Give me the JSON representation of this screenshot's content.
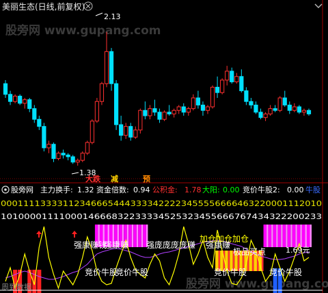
{
  "header": {
    "title": "美丽生态(日线,前复权)"
  },
  "watermark": "股旁网 www.gupang.com",
  "top_chart": {
    "high_label": "2.13",
    "low_label": "1.38",
    "signals": [
      {
        "text": "大跌",
        "color": "#ff3030"
      },
      {
        "text": "减",
        "color": "#ffd000"
      },
      {
        "text": "预",
        "color": "#ff8800"
      }
    ]
  },
  "indicator": {
    "title": "股旁网",
    "fields": [
      {
        "label": "主力换手:",
        "value": "1.32",
        "color": "#ffffff"
      },
      {
        "label": "资金倍数:",
        "value": "0.94",
        "color": "#ffffff"
      },
      {
        "label": "公积金:",
        "value": "1.78",
        "color": "#ff3030"
      },
      {
        "label": "大阳:",
        "value": "0.00",
        "color": "#00ff00"
      },
      {
        "label": "竞价牛股2:",
        "value": "0.00",
        "color": "#ffffff"
      }
    ],
    "suffix": "牛股",
    "digit_rows": [
      "000111133331123466654443333422223455556666463220001112010",
      "1010000111100014666832233334525323455666767434322200233"
    ],
    "labels": [
      {
        "text": "强康赚钱",
        "color": "#ffffff"
      },
      {
        "text": "强康赚",
        "color": "#ffffff"
      },
      {
        "text": "强庞庞庞庞赚",
        "color": "#ffffff"
      },
      {
        "text": "加仓加仓加仓",
        "color": "#ffff00"
      },
      {
        "text": "强康赚",
        "color": "#ffffff"
      },
      {
        "text": "极品买点",
        "color": "#ffffff"
      },
      {
        "text": "1.69元",
        "color": "#ffffff"
      },
      {
        "text": "竞价牛股",
        "color": "#ffffff"
      },
      {
        "text": "竞价牛股",
        "color": "#ffffff"
      },
      {
        "text": "竞价牛股",
        "color": "#ffffff"
      },
      {
        "text": "竞价牛股",
        "color": "#ffffff"
      },
      {
        "text": "周到数据",
        "color": "#888888"
      }
    ]
  },
  "colors": {
    "up": "#ff3030",
    "down": "#00e0ff",
    "axis": "#a00000",
    "dotgrid": "#7a0000",
    "magenta": "#ff00ff",
    "yellow": "#ffff00"
  },
  "chart_data": [
    {
      "type": "candlestick",
      "title": "美丽生态(日线,前复权)",
      "ohlc": [
        [
          1.84,
          1.86,
          1.76,
          1.78
        ],
        [
          1.78,
          1.8,
          1.72,
          1.74
        ],
        [
          1.74,
          1.78,
          1.73,
          1.77
        ],
        [
          1.77,
          1.78,
          1.72,
          1.73
        ],
        [
          1.73,
          1.76,
          1.7,
          1.75
        ],
        [
          1.75,
          1.76,
          1.68,
          1.7
        ],
        [
          1.7,
          1.72,
          1.62,
          1.64
        ],
        [
          1.64,
          1.66,
          1.58,
          1.6
        ],
        [
          1.6,
          1.62,
          1.46,
          1.48
        ],
        [
          1.48,
          1.52,
          1.45,
          1.5
        ],
        [
          1.5,
          1.51,
          1.4,
          1.42
        ],
        [
          1.42,
          1.46,
          1.41,
          1.45
        ],
        [
          1.45,
          1.47,
          1.42,
          1.44
        ],
        [
          1.44,
          1.45,
          1.41,
          1.43
        ],
        [
          1.43,
          1.44,
          1.39,
          1.4
        ],
        [
          1.4,
          1.42,
          1.38,
          1.41
        ],
        [
          1.41,
          1.46,
          1.4,
          1.45
        ],
        [
          1.45,
          1.52,
          1.44,
          1.51
        ],
        [
          1.51,
          1.64,
          1.5,
          1.63
        ],
        [
          1.63,
          1.76,
          1.62,
          1.74
        ],
        [
          1.74,
          1.85,
          1.72,
          1.84
        ],
        [
          1.84,
          2.13,
          1.82,
          2.02
        ],
        [
          2.02,
          2.04,
          1.8,
          1.84
        ],
        [
          1.84,
          1.86,
          1.58,
          1.61
        ],
        [
          1.61,
          1.66,
          1.52,
          1.55
        ],
        [
          1.55,
          1.62,
          1.53,
          1.6
        ],
        [
          1.6,
          1.62,
          1.52,
          1.54
        ],
        [
          1.54,
          1.6,
          1.53,
          1.58
        ],
        [
          1.58,
          1.7,
          1.56,
          1.69
        ],
        [
          1.69,
          1.74,
          1.64,
          1.66
        ],
        [
          1.66,
          1.72,
          1.64,
          1.7
        ],
        [
          1.7,
          1.75,
          1.66,
          1.68
        ],
        [
          1.68,
          1.7,
          1.62,
          1.64
        ],
        [
          1.64,
          1.69,
          1.63,
          1.68
        ],
        [
          1.68,
          1.72,
          1.66,
          1.67
        ],
        [
          1.67,
          1.7,
          1.65,
          1.69
        ],
        [
          1.69,
          1.72,
          1.67,
          1.71
        ],
        [
          1.71,
          1.73,
          1.66,
          1.68
        ],
        [
          1.68,
          1.71,
          1.66,
          1.7
        ],
        [
          1.7,
          1.78,
          1.69,
          1.76
        ],
        [
          1.76,
          1.8,
          1.7,
          1.72
        ],
        [
          1.72,
          1.74,
          1.66,
          1.69
        ],
        [
          1.69,
          1.72,
          1.67,
          1.71
        ],
        [
          1.71,
          1.83,
          1.7,
          1.82
        ],
        [
          1.82,
          1.88,
          1.76,
          1.79
        ],
        [
          1.79,
          1.87,
          1.78,
          1.86
        ],
        [
          1.86,
          1.94,
          1.83,
          1.91
        ],
        [
          1.91,
          1.93,
          1.84,
          1.85
        ],
        [
          1.85,
          1.9,
          1.84,
          1.88
        ],
        [
          1.88,
          1.92,
          1.79,
          1.8
        ],
        [
          1.8,
          1.82,
          1.72,
          1.74
        ],
        [
          1.74,
          1.76,
          1.7,
          1.72
        ],
        [
          1.72,
          1.74,
          1.67,
          1.68
        ],
        [
          1.68,
          1.7,
          1.64,
          1.65
        ],
        [
          1.65,
          1.68,
          1.63,
          1.67
        ],
        [
          1.67,
          1.72,
          1.66,
          1.7
        ],
        [
          1.7,
          1.72,
          1.68,
          1.69
        ],
        [
          1.69,
          1.77,
          1.68,
          1.76
        ],
        [
          1.76,
          1.8,
          1.71,
          1.72
        ],
        [
          1.72,
          1.74,
          1.67,
          1.69
        ],
        [
          1.69,
          1.73,
          1.68,
          1.71
        ],
        [
          1.71,
          1.72,
          1.67,
          1.68
        ],
        [
          1.68,
          1.7,
          1.66,
          1.69
        ],
        [
          1.69,
          1.7,
          1.66,
          1.67
        ]
      ],
      "ylim": [
        1.33,
        2.24
      ]
    },
    {
      "type": "bar+line",
      "series": [
        {
          "type": "magenta_bars",
          "values": [
            0,
            0,
            0,
            0,
            0,
            0,
            0,
            0,
            0,
            0,
            0,
            0,
            0,
            0,
            0,
            0,
            0,
            0,
            0,
            1,
            1,
            1,
            1,
            1,
            1,
            1,
            1,
            1,
            1,
            1,
            0,
            0,
            0,
            0,
            0,
            0,
            0,
            0,
            0,
            0,
            0,
            0,
            0,
            0,
            0,
            0,
            0,
            0,
            0,
            0,
            0,
            0,
            0,
            0,
            1,
            1,
            1,
            1,
            1,
            1,
            1,
            1,
            1,
            1
          ]
        },
        {
          "type": "yellow_bars",
          "values": [
            0,
            0,
            0,
            0,
            0,
            0,
            0,
            0,
            0,
            0,
            0,
            0,
            0,
            0,
            0,
            0,
            0,
            0,
            0,
            0,
            0,
            0,
            0,
            0,
            0,
            0,
            0,
            0,
            0,
            0,
            0,
            0,
            0,
            0,
            0,
            0,
            0,
            0,
            0,
            0,
            0,
            0,
            0,
            0,
            1,
            1,
            1,
            1,
            1,
            1,
            1,
            1,
            1,
            1,
            0,
            0,
            0,
            0,
            0,
            0,
            0,
            0,
            0,
            0
          ]
        },
        {
          "type": "red_bars",
          "values": [
            0,
            0,
            1,
            1,
            0,
            1,
            1,
            1,
            0,
            0,
            0,
            0,
            0,
            0,
            0,
            0,
            0,
            0,
            0,
            0,
            0,
            0,
            0,
            0,
            0,
            0,
            0,
            0,
            0,
            0,
            0,
            0,
            0,
            0,
            0,
            0,
            0,
            0,
            0,
            0,
            0,
            0,
            0,
            0,
            0,
            0,
            0,
            0,
            0,
            0,
            0,
            0,
            0,
            0,
            0,
            0,
            0,
            0,
            0,
            0,
            0,
            0,
            0,
            0
          ]
        },
        {
          "type": "blue_bars",
          "values": [
            0,
            0,
            0,
            0,
            0,
            0,
            0,
            0,
            0,
            0,
            0,
            0,
            0,
            0,
            0,
            0,
            0,
            0,
            0,
            0,
            0,
            0,
            0,
            0,
            0,
            0,
            0,
            0,
            0,
            0,
            0,
            0,
            0,
            0,
            0,
            0,
            0,
            0,
            0,
            0,
            0,
            0,
            0,
            0,
            0,
            0,
            0,
            0,
            0,
            0,
            0,
            0,
            0,
            0,
            0,
            0,
            1,
            1,
            0,
            0,
            0,
            0,
            0,
            0
          ]
        },
        {
          "type": "yellow_line",
          "values": [
            0.15,
            0.35,
            0.05,
            0.25,
            0.55,
            0.3,
            0.1,
            0.65,
            0.95,
            0.5,
            0.25,
            0.05,
            0.3,
            0.2,
            0.1,
            0.25,
            0.5,
            0.8,
            0.6,
            0.3,
            0.15,
            0.1,
            0.12,
            0.35,
            0.55,
            0.75,
            0.5,
            0.32,
            0.25,
            0.2,
            0.4,
            0.55,
            0.45,
            0.2,
            0.1,
            0.3,
            0.55,
            0.95,
            0.7,
            0.4,
            0.55,
            0.75,
            0.5,
            0.35,
            0.9,
            0.6,
            0.3,
            0.12,
            0.1,
            0.2,
            0.4,
            0.75,
            0.6,
            0.35,
            0.15,
            0.25,
            0.55,
            0.35,
            0.15,
            0.3,
            0.5,
            0.7,
            0.45,
            0.5
          ]
        },
        {
          "type": "purple_line",
          "values": [
            0.2,
            0.22,
            0.25,
            0.28,
            0.3,
            0.28,
            0.25,
            0.22,
            0.2,
            0.18,
            0.18,
            0.2,
            0.22,
            0.25,
            0.28,
            0.3,
            0.35,
            0.4,
            0.48,
            0.55,
            0.58,
            0.6,
            0.62,
            0.63,
            0.62,
            0.6,
            0.58,
            0.55,
            0.52,
            0.5,
            0.5,
            0.52,
            0.55,
            0.57,
            0.58,
            0.6,
            0.62,
            0.64,
            0.66,
            0.68,
            0.7,
            0.72,
            0.73,
            0.74,
            0.75,
            0.74,
            0.72,
            0.7,
            0.68,
            0.66,
            0.62,
            0.58,
            0.55,
            0.52,
            0.5,
            0.48,
            0.47,
            0.47,
            0.48,
            0.5,
            0.52,
            0.55,
            0.57,
            0.58
          ]
        }
      ],
      "markers": [
        {
          "type": "arrow_up",
          "index": 6
        },
        {
          "type": "arrow_up",
          "index": 13
        }
      ]
    }
  ]
}
